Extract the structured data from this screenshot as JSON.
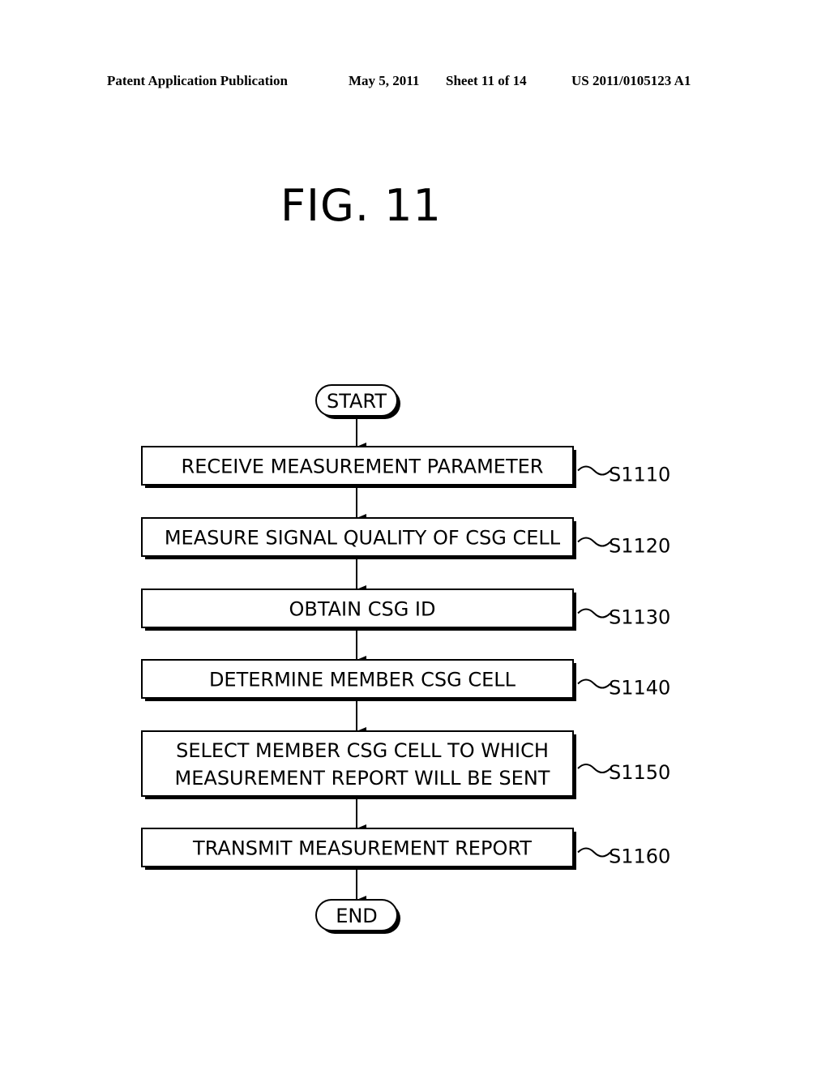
{
  "header": {
    "publication": "Patent Application Publication",
    "date": "May 5, 2011",
    "sheet": "Sheet 11 of 14",
    "number": "US 2011/0105123 A1"
  },
  "figure": {
    "title": "FIG. 11"
  },
  "flowchart": {
    "start": "START",
    "end": "END",
    "steps": [
      {
        "lines": [
          "RECEIVE MEASUREMENT PARAMETER"
        ],
        "label": "S1110"
      },
      {
        "lines": [
          "MEASURE SIGNAL QUALITY OF CSG CELL"
        ],
        "label": "S1120"
      },
      {
        "lines": [
          "OBTAIN CSG ID"
        ],
        "label": "S1130"
      },
      {
        "lines": [
          "DETERMINE MEMBER CSG CELL"
        ],
        "label": "S1140"
      },
      {
        "lines": [
          "SELECT MEMBER CSG CELL TO WHICH",
          "MEASUREMENT REPORT WILL BE SENT"
        ],
        "label": "S1150"
      },
      {
        "lines": [
          "TRANSMIT MEASUREMENT REPORT"
        ],
        "label": "S1160"
      }
    ]
  }
}
